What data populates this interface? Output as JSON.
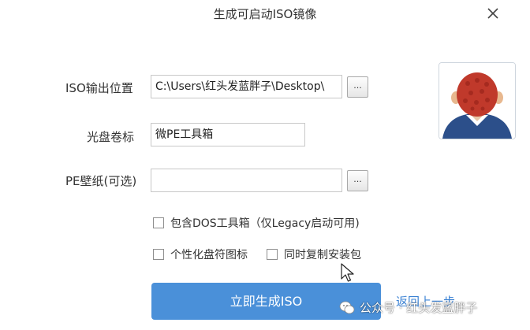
{
  "window": {
    "title": "生成可启动ISO镜像"
  },
  "form": {
    "iso_output_label": "ISO输出位置",
    "iso_output_value": "C:\\Users\\红头发蓝胖子\\Desktop\\",
    "volume_label": "光盘卷标",
    "volume_value": "微PE工具箱",
    "wallpaper_label": "PE壁纸(可选)",
    "wallpaper_value": "",
    "browse_label": "..."
  },
  "options": {
    "include_dos": {
      "label": "包含DOS工具箱（仅Legacy启动可用)",
      "checked": false
    },
    "personalize_icon": {
      "label": "个性化盘符图标",
      "checked": false
    },
    "copy_installer": {
      "label": "同时复制安装包",
      "checked": false
    }
  },
  "actions": {
    "generate_label": "立即生成ISO",
    "back_label": "返回上一步"
  },
  "watermark": {
    "text": "公众号 · 红头发蓝胖子"
  },
  "colors": {
    "primary": "#4a90d9",
    "link": "#3d83d4",
    "field_border": "#c8c8c8",
    "avatar_hair": "#c0392b",
    "avatar_shirt": "#2c4f8a"
  },
  "icons": {
    "close": "close-icon",
    "browse": "ellipsis",
    "avatar": "red-hair-person-back-view",
    "watermark": "wechat-icon",
    "cursor": "mouse-pointer-icon"
  }
}
